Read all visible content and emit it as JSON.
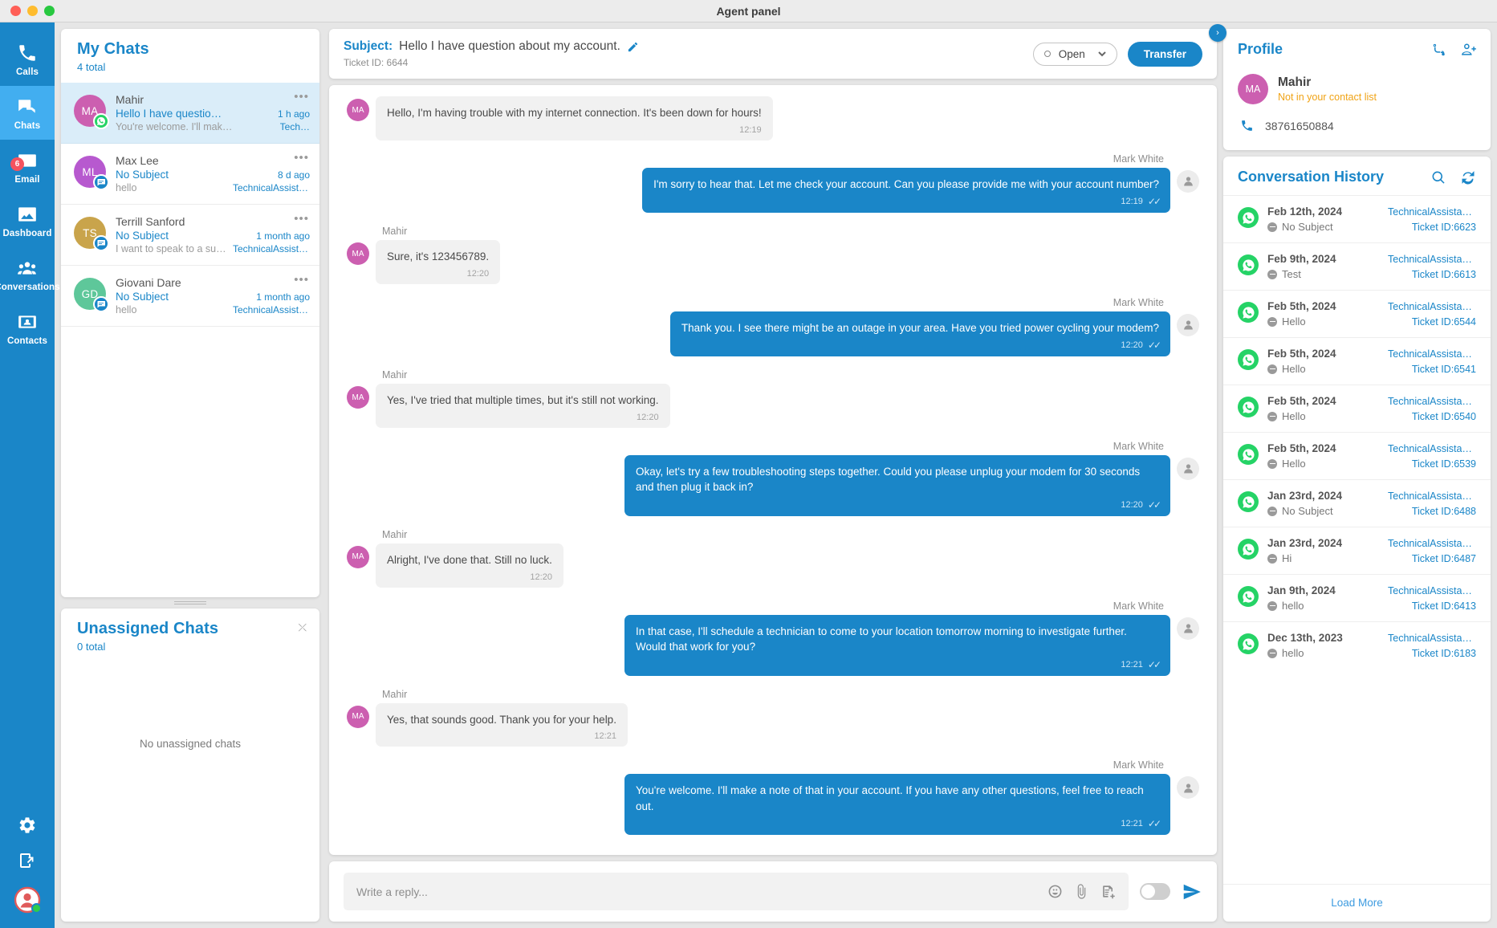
{
  "window": {
    "title": "Agent panel"
  },
  "rail": {
    "items": [
      {
        "label": "Calls",
        "icon": "phone-icon",
        "active": false,
        "badge": ""
      },
      {
        "label": "Chats",
        "icon": "chat-bubbles-icon",
        "active": true,
        "badge": ""
      },
      {
        "label": "Email",
        "icon": "envelope-icon",
        "active": false,
        "badge": "6"
      },
      {
        "label": "Dashboard",
        "icon": "dashboard-icon",
        "active": false,
        "badge": ""
      },
      {
        "label": "Conversations",
        "icon": "people-icon",
        "active": false,
        "badge": ""
      },
      {
        "label": "Contacts",
        "icon": "contact-card-icon",
        "active": false,
        "badge": ""
      }
    ],
    "bottom": [
      {
        "name": "settings-gear-icon"
      },
      {
        "name": "logout-icon"
      },
      {
        "name": "current-user-avatar"
      }
    ]
  },
  "my_chats": {
    "title": "My Chats",
    "subtitle": "4 total",
    "rows": [
      {
        "initials": "MA",
        "color": "#cc5fb0",
        "channel": "wa",
        "name": "Mahir",
        "subject": "Hello I have questio…",
        "time": "1 h ago",
        "preview": "You're welcome. I'll make a note of th…",
        "dept": "Tech…",
        "selected": true
      },
      {
        "initials": "ML",
        "color": "#b759cf",
        "channel": "sms",
        "name": "Max Lee",
        "subject": "No Subject",
        "time": "8 d ago",
        "preview": "hello",
        "dept": "TechnicalAssistan…",
        "selected": false
      },
      {
        "initials": "TS",
        "color": "#c9a44b",
        "channel": "sms",
        "name": "Terrill Sanford",
        "subject": "No Subject",
        "time": "1 month ago",
        "preview": "I want to speak to a superv…",
        "dept": "TechnicalAssista…",
        "selected": false
      },
      {
        "initials": "GD",
        "color": "#5ec79a",
        "channel": "sms",
        "name": "Giovani Dare",
        "subject": "No Subject",
        "time": "1 month ago",
        "preview": "hello",
        "dept": "TechnicalAssistan…",
        "selected": false
      }
    ]
  },
  "unassigned": {
    "title": "Unassigned Chats",
    "subtitle": "0 total",
    "empty_text": "No unassigned chats"
  },
  "conversation": {
    "subject_label": "Subject:",
    "subject_text": "Hello I have question about my account.",
    "ticket_id": "Ticket ID: 6644",
    "status": "Open",
    "transfer_label": "Transfer",
    "messages": [
      {
        "dir": "in",
        "sender": "",
        "show_sender": false,
        "initials": "MA",
        "color": "#cc5fb0",
        "text": "Hello, I'm having trouble with my internet connection. It's been down for hours!",
        "time": "12:19",
        "ticks": false
      },
      {
        "dir": "out",
        "sender": "Mark White",
        "show_sender": true,
        "text": "I'm sorry to hear that. Let me check your account. Can you please provide me with your account number?",
        "time": "12:19",
        "ticks": true
      },
      {
        "dir": "in",
        "sender": "Mahir",
        "show_sender": true,
        "initials": "MA",
        "color": "#cc5fb0",
        "text": "Sure, it's 123456789.",
        "time": "12:20",
        "ticks": false
      },
      {
        "dir": "out",
        "sender": "Mark White",
        "show_sender": true,
        "text": "Thank you. I see there might be an outage in your area. Have you tried power cycling your modem?",
        "time": "12:20",
        "ticks": true
      },
      {
        "dir": "in",
        "sender": "Mahir",
        "show_sender": true,
        "initials": "MA",
        "color": "#cc5fb0",
        "text": "Yes, I've tried that multiple times, but it's still not working.",
        "time": "12:20",
        "ticks": false
      },
      {
        "dir": "out",
        "sender": "Mark White",
        "show_sender": true,
        "text": "Okay, let's try a few troubleshooting steps together. Could you please unplug your modem for 30 seconds and then plug it back in?",
        "time": "12:20",
        "ticks": true
      },
      {
        "dir": "in",
        "sender": "Mahir",
        "show_sender": true,
        "initials": "MA",
        "color": "#cc5fb0",
        "text": "Alright, I've done that. Still no luck.",
        "time": "12:20",
        "ticks": false
      },
      {
        "dir": "out",
        "sender": "Mark White",
        "show_sender": true,
        "text": "In that case, I'll schedule a technician to come to your location tomorrow morning to investigate further. Would that work for you?",
        "time": "12:21",
        "ticks": true
      },
      {
        "dir": "in",
        "sender": "Mahir",
        "show_sender": true,
        "initials": "MA",
        "color": "#cc5fb0",
        "text": "Yes, that sounds good. Thank you for your help.",
        "time": "12:21",
        "ticks": false
      },
      {
        "dir": "out",
        "sender": "Mark White",
        "show_sender": true,
        "text": "You're welcome. I'll make a note of that in your account. If you have any other questions, feel free to reach out.",
        "time": "12:21",
        "ticks": true
      }
    ],
    "composer": {
      "placeholder": "Write a reply...",
      "value": "",
      "icons": [
        "emoji-icon",
        "attachment-icon",
        "template-icon"
      ],
      "toggle_on": false
    }
  },
  "profile": {
    "title": "Profile",
    "initials": "MA",
    "name": "Mahir",
    "note": "Not in your contact list",
    "phone": "38761650884",
    "actions": [
      "merge-contact-icon",
      "add-contact-icon"
    ]
  },
  "history": {
    "title": "Conversation History",
    "actions": [
      "search-icon",
      "refresh-icon"
    ],
    "load_more": "Load More",
    "ticket_prefix": "Ticket ID:",
    "rows": [
      {
        "date": "Feb 12th, 2024",
        "subject": "No Subject",
        "dept": "TechnicalAssistan…",
        "ticket": "6623"
      },
      {
        "date": "Feb 9th, 2024",
        "subject": "Test",
        "dept": "TechnicalAssistan…",
        "ticket": "6613"
      },
      {
        "date": "Feb 5th, 2024",
        "subject": "Hello",
        "dept": "TechnicalAssistan…",
        "ticket": "6544"
      },
      {
        "date": "Feb 5th, 2024",
        "subject": "Hello",
        "dept": "TechnicalAssistan…",
        "ticket": "6541"
      },
      {
        "date": "Feb 5th, 2024",
        "subject": "Hello",
        "dept": "TechnicalAssistan…",
        "ticket": "6540"
      },
      {
        "date": "Feb 5th, 2024",
        "subject": "Hello",
        "dept": "TechnicalAssistan…",
        "ticket": "6539"
      },
      {
        "date": "Jan 23rd, 2024",
        "subject": "No Subject",
        "dept": "TechnicalAssistan…",
        "ticket": "6488"
      },
      {
        "date": "Jan 23rd, 2024",
        "subject": "Hi",
        "dept": "TechnicalAssistan…",
        "ticket": "6487"
      },
      {
        "date": "Jan 9th, 2024",
        "subject": "hello",
        "dept": "TechnicalAssistan…",
        "ticket": "6413"
      },
      {
        "date": "Dec 13th, 2023",
        "subject": "hello",
        "dept": "TechnicalAssistan…",
        "ticket": "6183"
      }
    ]
  },
  "colors": {
    "accent": "#1a86c8",
    "rail": "#1a86c8",
    "rail_active": "#42aef0",
    "whatsapp": "#25d366",
    "warn": "#f0a315"
  }
}
